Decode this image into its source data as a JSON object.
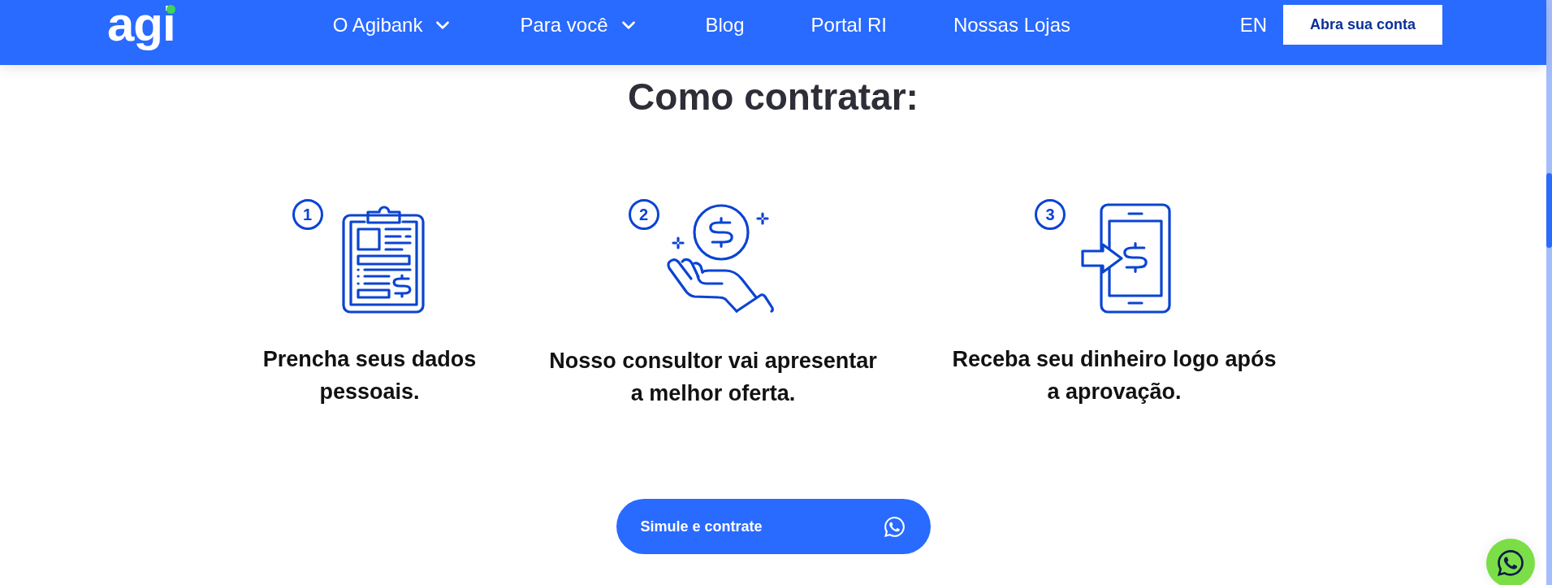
{
  "header": {
    "logo": "agi",
    "nav": [
      {
        "label": "O Agibank",
        "dropdown": true
      },
      {
        "label": "Para você",
        "dropdown": true
      },
      {
        "label": "Blog",
        "dropdown": false
      },
      {
        "label": "Portal RI",
        "dropdown": false
      },
      {
        "label": "Nossas Lojas",
        "dropdown": false
      }
    ],
    "language": "EN",
    "cta": "Abra sua conta"
  },
  "section": {
    "title": "Como contratar:",
    "steps": [
      {
        "number": "1",
        "kind": "clipboard",
        "lines": [
          "Prencha seus dados",
          "pessoais."
        ]
      },
      {
        "number": "2",
        "kind": "hand-coin",
        "lines": [
          "Nosso consultor vai apresentar",
          "a melhor oferta."
        ]
      },
      {
        "number": "3",
        "kind": "phone",
        "lines": [
          "Receba seu dinheiro logo após",
          "a aprovação."
        ]
      }
    ],
    "button": {
      "label": "Simule e contrate"
    }
  }
}
